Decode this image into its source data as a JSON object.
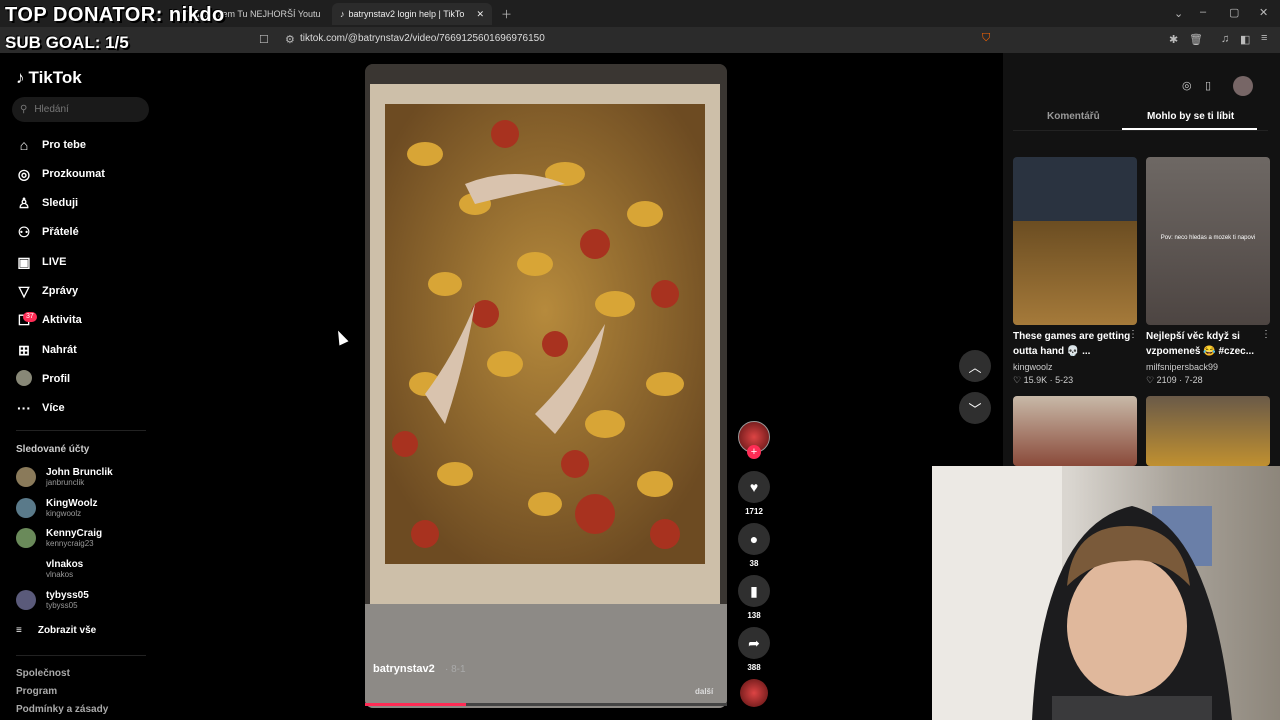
{
  "overlay": {
    "top_donator": "TOP DONATOR: nikdo",
    "sub_goal": "SUB GOAL: 1/5"
  },
  "browser": {
    "tab_prev_title": "Našel Jsem Tu NEJHORŠÍ Youtu",
    "tab_active_title": "batrynstav2 login help | TikTo",
    "url": "tiktok.com/@batrynstav2/video/7669125601696976150"
  },
  "sidebar": {
    "logo": "TikTok",
    "search_placeholder": "Hledání",
    "nav": [
      {
        "label": "Pro tebe",
        "icon": "home-icon"
      },
      {
        "label": "Prozkoumat",
        "icon": "compass-icon"
      },
      {
        "label": "Sleduji",
        "icon": "following-icon"
      },
      {
        "label": "Přátelé",
        "icon": "friends-icon"
      },
      {
        "label": "LIVE",
        "icon": "live-icon"
      },
      {
        "label": "Zprávy",
        "icon": "messages-icon"
      },
      {
        "label": "Aktivita",
        "icon": "activity-icon"
      },
      {
        "label": "Nahrát",
        "icon": "upload-icon"
      },
      {
        "label": "Profil",
        "icon": "profile-avatar"
      },
      {
        "label": "Více",
        "icon": "more-icon"
      }
    ],
    "activity_badge": "37",
    "following_title": "Sledované účty",
    "accounts": [
      {
        "name": "John Brunclik",
        "handle": "janbrunclik"
      },
      {
        "name": "KingWoolz",
        "handle": "kingwoolz"
      },
      {
        "name": "KennyCraig",
        "handle": "kennycraig23"
      },
      {
        "name": "vlnakos",
        "handle": "vlnakos"
      },
      {
        "name": "tybyss05",
        "handle": "tybyss05"
      }
    ],
    "show_all": "Zobrazit vše",
    "footer": [
      "Společnost",
      "Program",
      "Podmínky a zásady"
    ]
  },
  "video": {
    "author": "batrynstav2",
    "date": "· 8-1",
    "next_label": "další",
    "progress": 0.28
  },
  "actions": {
    "likes": "1712",
    "comments": "38",
    "bookmarks": "138",
    "shares": "388"
  },
  "right_panel": {
    "tab_comments": "Komentářů",
    "tab_related": "Mohlo by se ti líbit",
    "videos": [
      {
        "title": "These games are getting outta hand 💀 ...",
        "author": "kingwoolz",
        "stats": "♡ 15.9K · 5-23"
      },
      {
        "title": "Nejlepší věc když si vzpomeneš 😂 #czec...",
        "author": "milfsnipersback99",
        "stats": "♡ 2109 · 7-28"
      }
    ],
    "thumb_caption": "Pov: neco hledas a mozek ti napovi"
  },
  "colors": {
    "accent": "#fe2c55",
    "background": "#000000",
    "panel": "#121212"
  }
}
